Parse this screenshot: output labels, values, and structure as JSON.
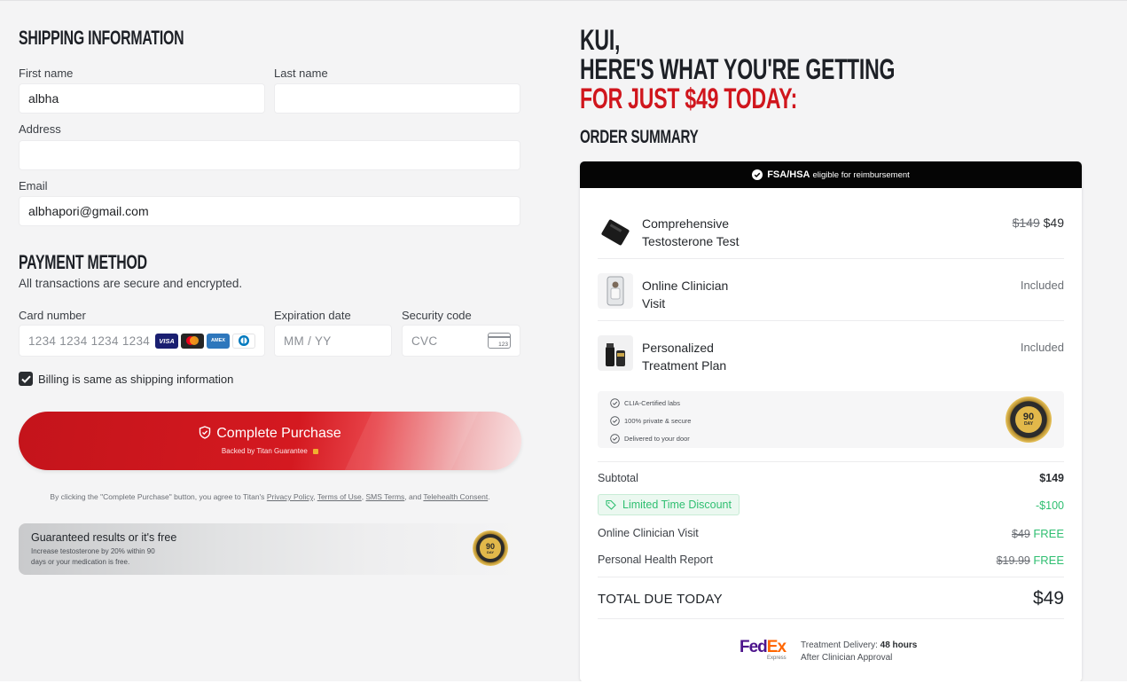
{
  "shipping": {
    "title": "SHIPPING INFORMATION",
    "first_name_label": "First name",
    "first_name_value": "albha",
    "last_name_label": "Last name",
    "last_name_value": "",
    "address_label": "Address",
    "address_value": "",
    "email_label": "Email",
    "email_value": "albhapori@gmail.com"
  },
  "payment": {
    "title": "PAYMENT METHOD",
    "subtitle": "All transactions are secure and encrypted.",
    "card_number_label": "Card number",
    "card_number_placeholder": "1234 1234 1234 1234",
    "expiration_label": "Expiration date",
    "expiration_placeholder": "MM / YY",
    "security_label": "Security code",
    "security_placeholder": "CVC",
    "cvc_icon_text": "123",
    "card_brands": [
      {
        "name": "visa",
        "text": "VISA",
        "color": "#1a1f71"
      },
      {
        "name": "mastercard",
        "text": "",
        "color": "#252525"
      },
      {
        "name": "amex",
        "text": "AMEX",
        "color": "#2e77bc"
      },
      {
        "name": "diners",
        "text": "",
        "color": "#ffffff"
      }
    ],
    "billing_same_label": "Billing is same as shipping information",
    "billing_same_checked": true
  },
  "cta": {
    "label": "Complete Purchase",
    "sublabel": "Backed by Titan Guarantee",
    "color": "#d41920"
  },
  "terms": {
    "prefix": "By clicking the \"Complete Purchase\" button, you agree to Titan's",
    "privacy": "Privacy Policy",
    "terms": "Terms of Use",
    "sms": "SMS Terms",
    "and": ", and",
    "telehealth": "Telehealth Consent"
  },
  "guarantee": {
    "title": "Guaranteed results or it's free",
    "text_line1": "Increase testosterone by 20% within 90",
    "text_line2": "days or your medication is free.",
    "badge_number": "90",
    "badge_unit": "DAY"
  },
  "headline": {
    "line1": "KUI,",
    "line2": "HERE'S WHAT YOU'RE GETTING",
    "line3": "FOR JUST $49 TODAY:",
    "accent_color": "#d0161d"
  },
  "order_summary": {
    "title": "ORDER SUMMARY",
    "banner_bold": "FSA/HSA",
    "banner_text": "eligible for reimbursement",
    "items": [
      {
        "name_line1": "Comprehensive",
        "name_line2": "Testosterone Test",
        "old_price": "$149",
        "price": "$49"
      },
      {
        "name_line1": "Online Clinician",
        "name_line2": "Visit",
        "old_price": "",
        "price": "Included"
      },
      {
        "name_line1": "Personalized",
        "name_line2": "Treatment Plan",
        "old_price": "",
        "price": "Included"
      }
    ],
    "features": [
      "CLIA-Certified labs",
      "100% private & secure",
      "Delivered to your door"
    ],
    "badge_number": "90",
    "badge_unit": "DAY",
    "subtotal_label": "Subtotal",
    "subtotal_value": "$149",
    "discount_label": "Limited Time Discount",
    "discount_value": "-$100",
    "clinician_label": "Online Clinician Visit",
    "clinician_old": "$49",
    "clinician_value": "FREE",
    "report_label": "Personal Health Report",
    "report_old": "$19.99",
    "report_value": "FREE",
    "total_label": "TOTAL DUE TODAY",
    "total_value": "$49",
    "fedex_fed": "Fed",
    "fedex_ex": "Ex",
    "fedex_express": "Express",
    "delivery_label": "Treatment Delivery:",
    "delivery_value": "48 hours",
    "delivery_note": "After Clinician Approval",
    "green": "#2fbf71"
  }
}
